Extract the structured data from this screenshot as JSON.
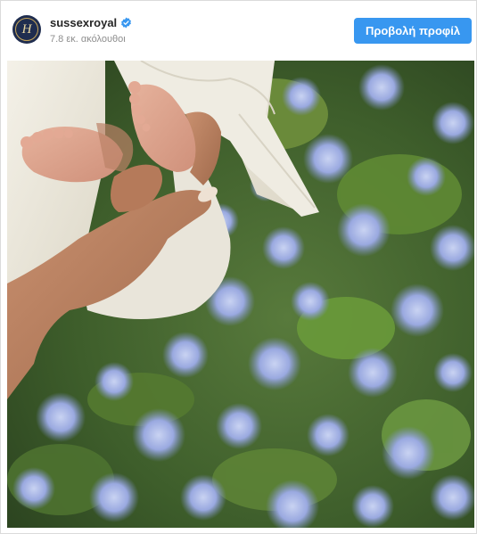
{
  "header": {
    "username": "sussexroyal",
    "followers": "7.8 εκ. ακόλουθοι",
    "profile_button_label": "Προβολή προφίλ",
    "avatar_icon": "monogram-h-icon",
    "verified_icon": "verified-badge-icon"
  },
  "post": {
    "image_icon": "post-photo"
  },
  "colors": {
    "accent": "#3897f0",
    "username": "#262626",
    "secondary_text": "#8e8e8e",
    "avatar_bg": "#1f2d4f"
  }
}
